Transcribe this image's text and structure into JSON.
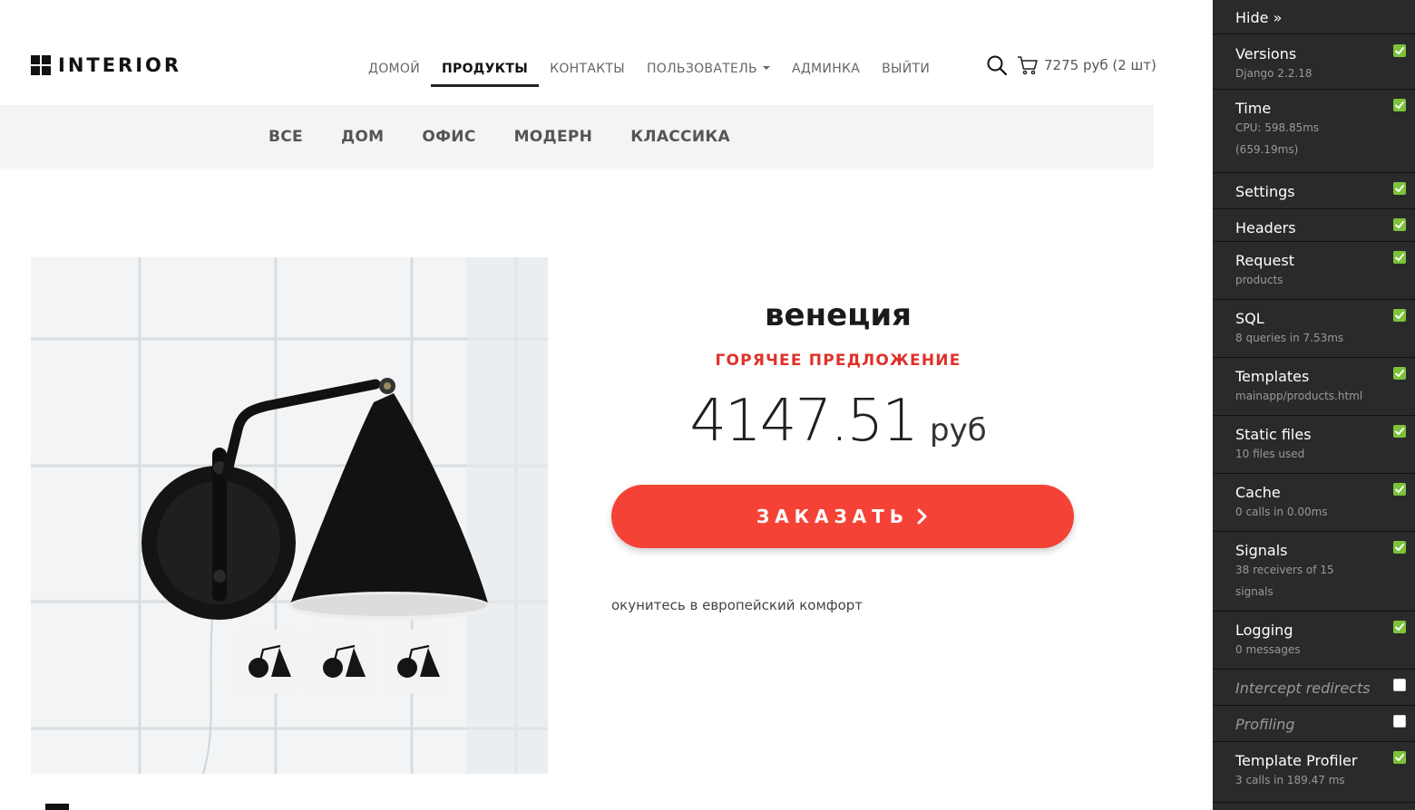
{
  "header": {
    "logo_text": "INTERIOR",
    "nav": [
      {
        "label": "ДОМОЙ",
        "active": false
      },
      {
        "label": "ПРОДУКТЫ",
        "active": true
      },
      {
        "label": "КОНТАКТЫ",
        "active": false
      },
      {
        "label": "ПОЛЬЗОВАТЕЛЬ",
        "active": false,
        "dropdown": true
      },
      {
        "label": "АДМИНКА",
        "active": false
      },
      {
        "label": "ВЫЙТИ",
        "active": false
      }
    ],
    "cart_text": "7275 руб (2 шт)",
    "icons": [
      "search-icon",
      "cart-icon"
    ]
  },
  "categories": [
    "ВСЕ",
    "ДОМ",
    "ОФИС",
    "МОДЕРН",
    "КЛАССИКА"
  ],
  "product": {
    "title": "венеция",
    "subtitle": "ГОРЯЧЕЕ ПРЕДЛОЖЕНИЕ",
    "price": "4147.51",
    "currency": "руб",
    "order_label": "ЗАКАЗАТЬ",
    "description": "окунитесь в европейский комфорт",
    "thumbnail_count": 3
  },
  "debug_toolbar": {
    "hide_label": "Hide »",
    "panels": [
      {
        "title": "Versions",
        "subtitle_lines": [
          "Django 2.2.18"
        ],
        "enabled": true
      },
      {
        "title": "Time",
        "subtitle_lines": [
          "CPU: 598.85ms",
          "(659.19ms)"
        ],
        "enabled": true
      },
      {
        "title": "Settings",
        "subtitle_lines": [],
        "enabled": true
      },
      {
        "title": "Headers",
        "subtitle_lines": [],
        "enabled": true
      },
      {
        "title": "Request",
        "subtitle_lines": [
          "products"
        ],
        "enabled": true
      },
      {
        "title": "SQL",
        "subtitle_lines": [
          "8 queries in 7.53ms"
        ],
        "enabled": true
      },
      {
        "title": "Templates",
        "subtitle_lines": [
          "mainapp/products.html"
        ],
        "enabled": true
      },
      {
        "title": "Static files",
        "subtitle_lines": [
          "10 files used"
        ],
        "enabled": true
      },
      {
        "title": "Cache",
        "subtitle_lines": [
          "0 calls in 0.00ms"
        ],
        "enabled": true
      },
      {
        "title": "Signals",
        "subtitle_lines": [
          "38 receivers of 15",
          "signals"
        ],
        "enabled": true
      },
      {
        "title": "Logging",
        "subtitle_lines": [
          "0 messages"
        ],
        "enabled": true
      },
      {
        "title": "Intercept redirects",
        "subtitle_lines": [],
        "enabled": false
      },
      {
        "title": "Profiling",
        "subtitle_lines": [],
        "enabled": false
      },
      {
        "title": "Template Profiler",
        "subtitle_lines": [
          "3 calls in 189.47 ms"
        ],
        "enabled": true
      }
    ]
  },
  "colors": {
    "accent_red": "#f44336",
    "subtitle_red": "#e0312a",
    "category_bar_bg": "#f4f4f4",
    "toolbar_bg": "#2a2a2a",
    "toolbar_check": "#7cc23b"
  }
}
